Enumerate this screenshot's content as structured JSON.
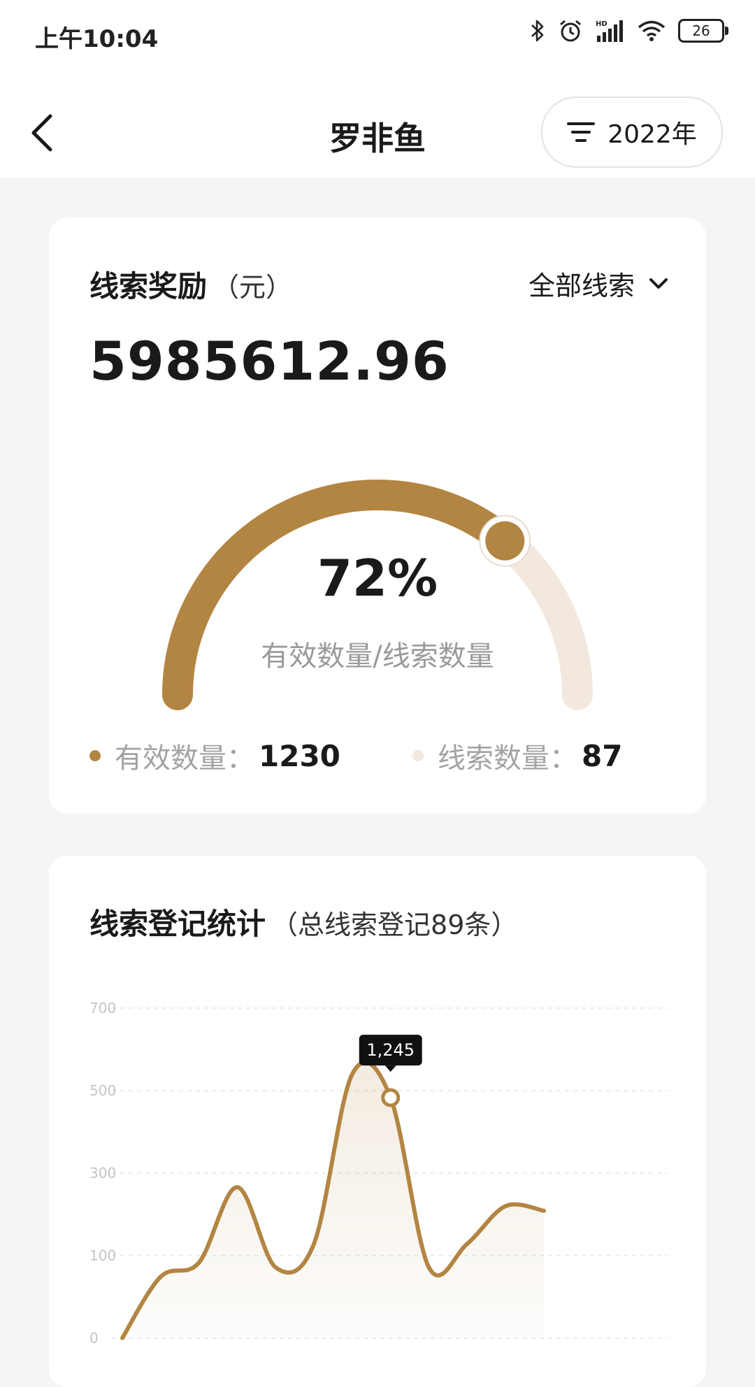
{
  "status_bar": {
    "time": "上午10:04",
    "battery": "26"
  },
  "nav": {
    "title": "罗非鱼",
    "year_filter": "2022年"
  },
  "reward_card": {
    "title": "线索奖励",
    "unit": "（元）",
    "dropdown_label": "全部线索",
    "amount": "5985612.96",
    "gauge": {
      "percent_text": "72%",
      "percent_value": 72,
      "subtitle": "有效数量/线索数量",
      "progress_color": "#b38542",
      "track_color": "#f2e8de"
    },
    "legend": {
      "valid_label": "有效数量：",
      "valid_value": "1230",
      "clue_label": "线索数量：",
      "clue_value": "87",
      "valid_color": "#b38542",
      "clue_color": "#f2e8de"
    }
  },
  "stats_card": {
    "title": "线索登记统计",
    "subtitle": "（总线索登记89条）"
  },
  "chart_data": {
    "type": "area",
    "x": [
      0,
      1,
      2,
      3,
      4,
      5,
      6,
      7,
      8,
      9,
      10,
      11
    ],
    "y": [
      0,
      130,
      160,
      320,
      150,
      200,
      560,
      510,
      150,
      200,
      280,
      270
    ],
    "ylim": [
      0,
      700
    ],
    "yticks": [
      "700",
      "500",
      "300",
      "100",
      "0"
    ],
    "tooltip": {
      "label": "1,245",
      "index": 7
    },
    "line_color": "#b38542",
    "grid": true
  }
}
